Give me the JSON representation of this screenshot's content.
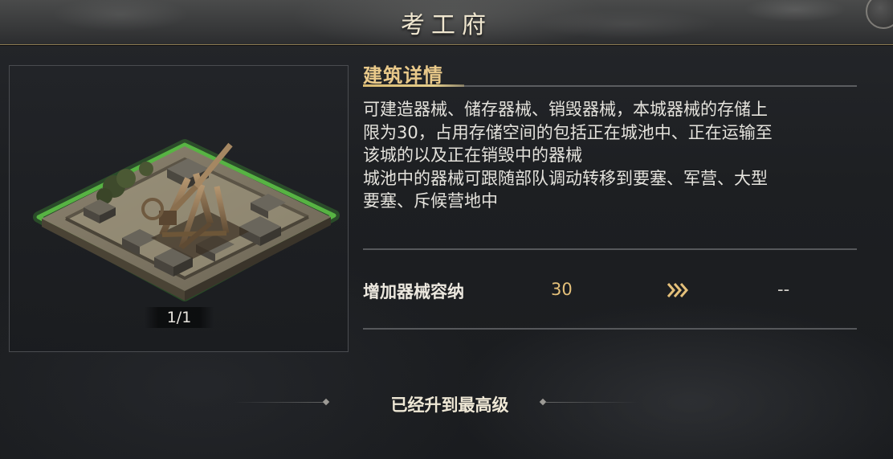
{
  "window": {
    "title": "考工府"
  },
  "building": {
    "page_indicator": "1/1",
    "icon": "siege-workshop-building-image"
  },
  "details": {
    "section_title": "建筑详情",
    "description_lines": [
      "可建造器械、储存器械、销毁器械，本城器械的存储上",
      "限为30，占用存储空间的包括正在城池中、正在运输至",
      "该城的以及正在销毁中的器械",
      "城池中的器械可跟随部队调动转移到要塞、军营、大型",
      "要塞、斥候营地中"
    ]
  },
  "stat": {
    "label": "增加器械容纳",
    "current_value": "30",
    "arrow_icon": "triple-chevron-right-icon",
    "next_value": "--"
  },
  "status": {
    "max_level_text": "已经升到最高级"
  },
  "colors": {
    "accent_gold": "#e9c98a",
    "value_gold": "#e4c07a",
    "grass_glow": "#5fd44a"
  }
}
